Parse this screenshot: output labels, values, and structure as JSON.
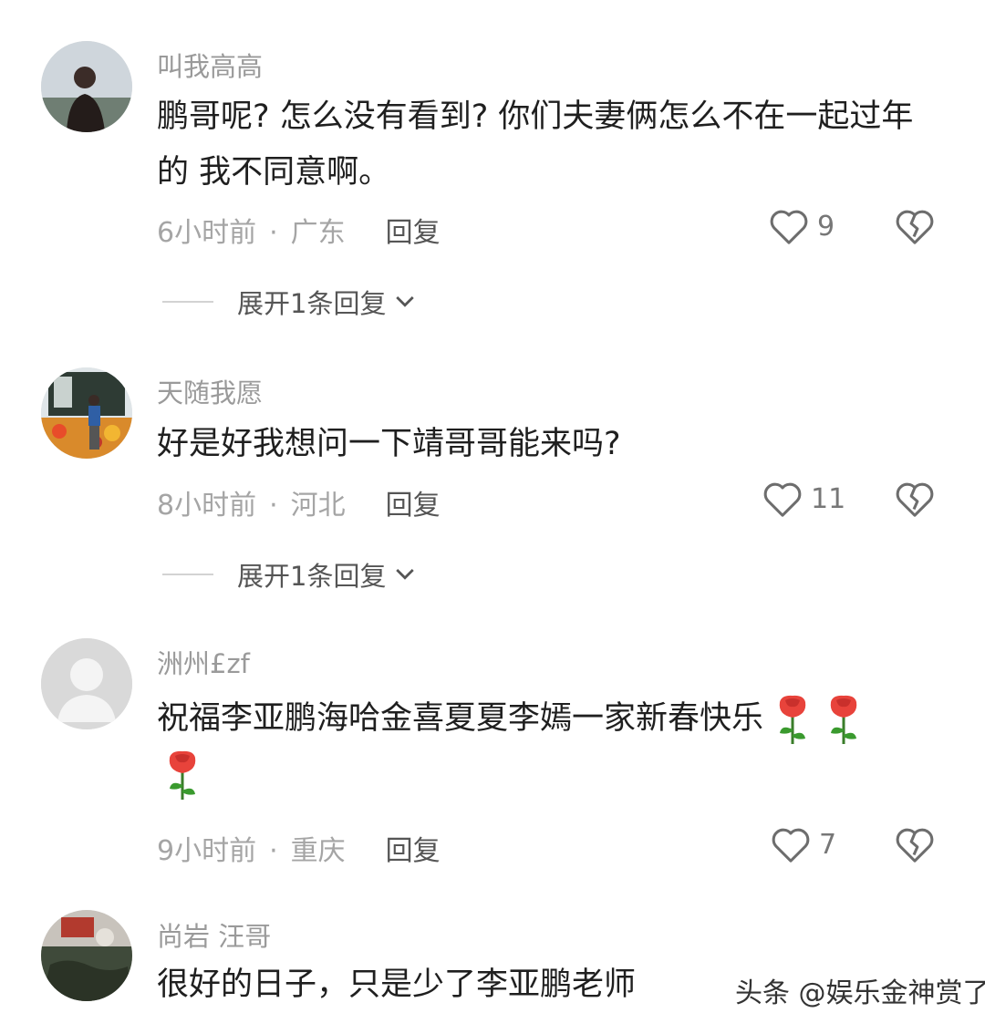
{
  "comments": [
    {
      "username": "叫我高高",
      "text": "鹏哥呢? 怎么没有看到? 你们夫妻俩怎么不在一起过年的   我不同意啊。",
      "time": "6小时前",
      "location": "广东",
      "reply_label": "回复",
      "likes": "9",
      "expand_label": "展开1条回复"
    },
    {
      "username": "天随我愿",
      "text": "好是好我想问一下靖哥哥能来吗?",
      "time": "8小时前",
      "location": "河北",
      "reply_label": "回复",
      "likes": "11",
      "expand_label": "展开1条回复"
    },
    {
      "username": "洲州£zf",
      "text": "祝福李亚鹏海哈金喜夏夏李嫣一家新春快乐",
      "emoji": "rose-emoji",
      "time": "9小时前",
      "location": "重庆",
      "reply_label": "回复",
      "likes": "7"
    },
    {
      "username": "尚岩 汪哥",
      "text": "很好的日子，只是少了李亚鹏老师"
    }
  ],
  "meta_separator": "·",
  "watermark": "头条 @娱乐金神赏了",
  "icons": [
    "heart-outline-icon",
    "broken-heart-icon",
    "chevron-down-icon",
    "rose-emoji"
  ]
}
